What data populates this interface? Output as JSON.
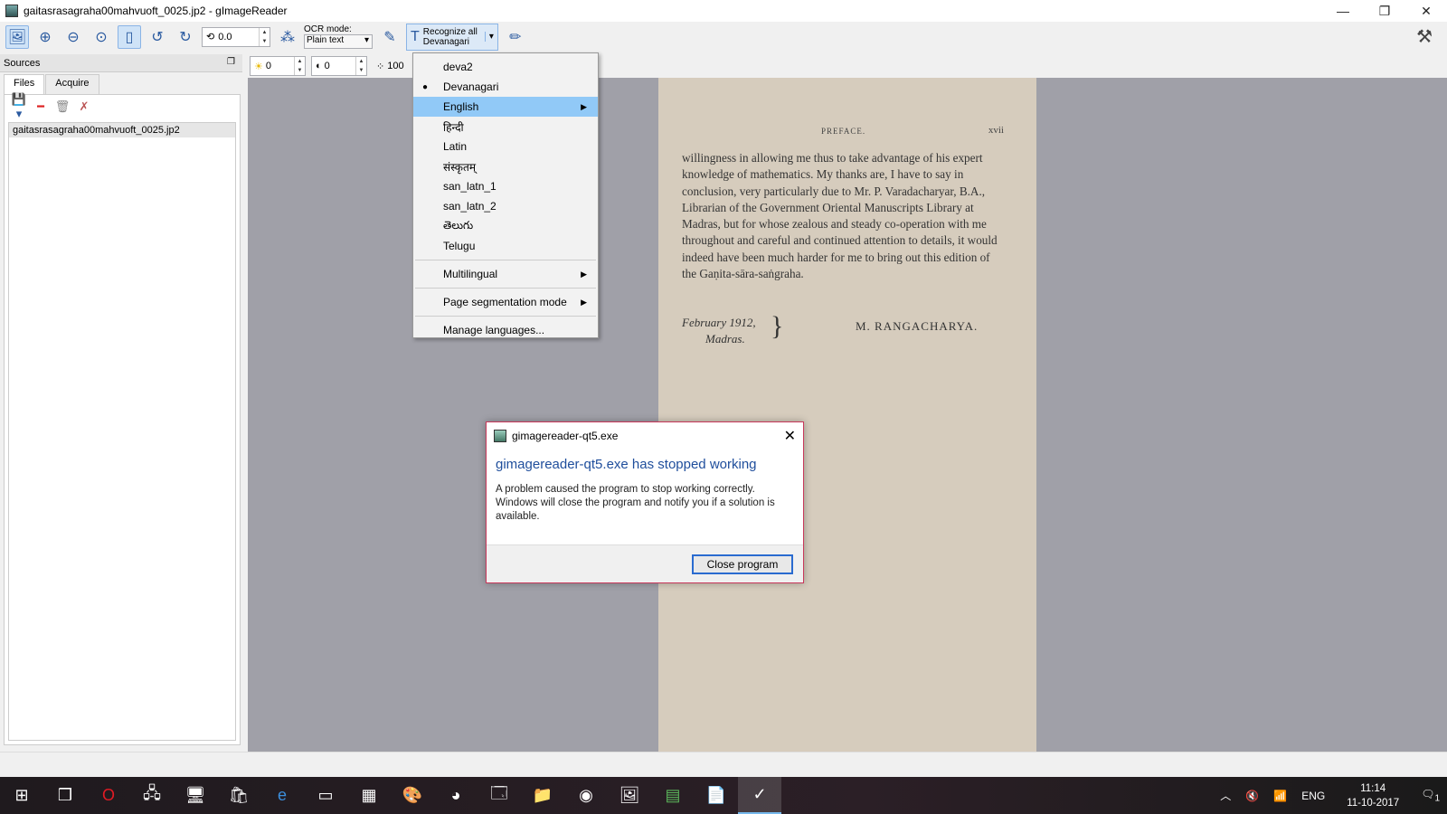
{
  "window": {
    "title": "gaitasrasagraha00mahvuoft_0025.jp2 - gImageReader",
    "minimize": "—",
    "restore": "❐",
    "close": "✕"
  },
  "toolbar": {
    "rotation_value": "0.0",
    "ocr_mode_label": "OCR mode:",
    "ocr_mode_value": "Plain text",
    "recognize_line1": "Recognize all",
    "recognize_line2": "Devanagari"
  },
  "sources": {
    "header": "Sources",
    "tabs": [
      "Files",
      "Acquire"
    ],
    "files": [
      "gaitasrasagraha00mahvuoft_0025.jp2"
    ]
  },
  "subtoolbar": {
    "brightness": "0",
    "contrast": "0",
    "resolution": "100"
  },
  "menu": {
    "items": [
      {
        "label": "deva2",
        "selected": false,
        "submenu": false
      },
      {
        "label": "Devanagari",
        "selected": true,
        "submenu": false
      },
      {
        "label": "English",
        "selected": false,
        "submenu": true,
        "highlight": true
      },
      {
        "label": "हिन्दी",
        "selected": false,
        "submenu": false
      },
      {
        "label": "Latin",
        "selected": false,
        "submenu": false
      },
      {
        "label": "संस्कृतम्",
        "selected": false,
        "submenu": false
      },
      {
        "label": "san_latn_1",
        "selected": false,
        "submenu": false
      },
      {
        "label": "san_latn_2",
        "selected": false,
        "submenu": false
      },
      {
        "label": "తెలుగు",
        "selected": false,
        "submenu": false
      },
      {
        "label": "Telugu",
        "selected": false,
        "submenu": false
      }
    ],
    "multilingual": "Multilingual",
    "page_segmentation": "Page segmentation mode",
    "manage_languages": "Manage languages..."
  },
  "page": {
    "header": "PREFACE.",
    "page_number": "xvii",
    "paragraph": "willingness in allowing me thus to take advantage of his expert knowledge of mathematics. My thanks are, I have to say in conclusion, very particularly due to Mr. P. Varadacharyar, B.A., Librarian of the Government Oriental Manuscripts Library at Madras, but for whose zealous and steady co-operation with me throughout and careful and continued attention to details, it would indeed have been much harder for me to bring out this edition of the Gaṇita-sāra-saṅgraha.",
    "date": "February 1912,",
    "place": "Madras.",
    "signature": "M. RANGACHARYA."
  },
  "dialog": {
    "title": "gimagereader-qt5.exe",
    "heading": "gimagereader-qt5.exe has stopped working",
    "message": "A problem caused the program to stop working correctly. Windows will close the program and notify you if a solution is available.",
    "button": "Close program"
  },
  "taskbar": {
    "language": "ENG",
    "time": "11:14",
    "date": "11-10-2017",
    "notification_count": "1"
  },
  "colors": {
    "menu_highlight": "#91c9f7",
    "dialog_heading": "#1f4e9c",
    "dialog_border": "#c8375a",
    "canvas_bg": "#a0a0a8",
    "page_bg": "#d6ccbd"
  }
}
